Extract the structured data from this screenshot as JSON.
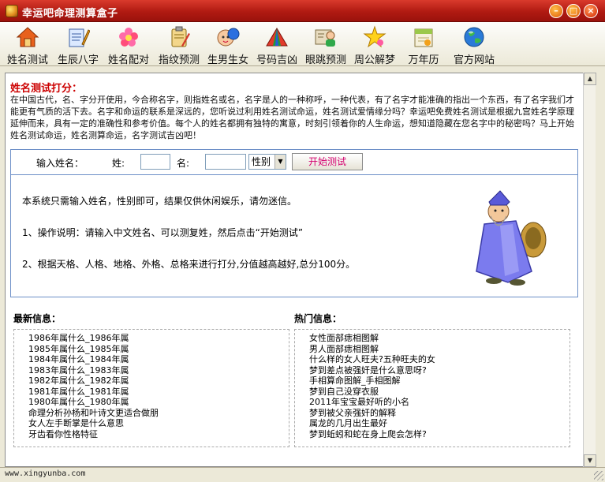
{
  "window": {
    "title": "幸运吧命理测算盒子"
  },
  "toolbar": [
    {
      "label": "姓名测试",
      "icon": "house-icon"
    },
    {
      "label": "生辰八字",
      "icon": "notepad-pen-icon"
    },
    {
      "label": "姓名配对",
      "icon": "flower-icon"
    },
    {
      "label": "指纹预测",
      "icon": "clipboard-icon"
    },
    {
      "label": "生男生女",
      "icon": "baby-icon"
    },
    {
      "label": "号码吉凶",
      "icon": "tent-icon"
    },
    {
      "label": "眼跳预测",
      "icon": "person-card-icon"
    },
    {
      "label": "周公解梦",
      "icon": "star-wand-icon"
    },
    {
      "label": "万年历",
      "icon": "calendar-icon"
    },
    {
      "label": "官方网站",
      "icon": "globe-icon"
    }
  ],
  "main": {
    "section_title": "姓名测试打分：",
    "intro": "在中国古代，名、字分开使用，今合称名字，则指姓名或名，名字是人的一种称呼，一种代表，有了名字才能准确的指出一个东西，有了名字我们才能更有气质的活下去。名字和命运的联系是深远的，您听说过利用姓名测试命运，姓名测试爱情缘分吗？幸运吧免费姓名测试是根据九宫姓名学原理延伸而来，具有一定的准确性和参考价值。每个人的姓名都拥有独特的寓意，时刻引领着你的人生命运，想知道隐藏在您名字中的秘密吗？马上开始姓名测试命运，姓名测算命运，名字测试吉凶吧！",
    "form": {
      "input_name_label": "输入姓名：",
      "surname_label": "姓:",
      "given_label": "名:",
      "surname_value": "",
      "given_value": "",
      "gender_selected": "性别",
      "start_button": "开始测试"
    },
    "notes": [
      "本系统只需输入姓名，性别即可，结果仅供休闲娱乐，请勿迷信。",
      "1、操作说明：请输入中文姓名、可以测复姓，然后点击“开始测试”",
      "2、根据天格、人格、地格、外格、总格来进行打分,分值越高越好,总分100分。"
    ],
    "latest_title": "最新信息：",
    "latest": [
      "1986年属什么_1986年属",
      "1985年属什么_1985年属",
      "1984年属什么_1984年属",
      "1983年属什么_1983年属",
      "1982年属什么_1982年属",
      "1981年属什么_1981年属",
      "1980年属什么_1980年属",
      "命理分析孙杨和叶诗文更适合做朋",
      "女人左手断掌是什么意思",
      "牙齿看你性格特征"
    ],
    "hot_title": "热门信息：",
    "hot": [
      "女性面部痣相图解",
      "男人面部痣相图解",
      "什么样的女人旺夫?五种旺夫的女",
      "梦到差点被强奸是什么意思呀?",
      "手相算命图解_手相图解",
      "梦到自己没穿衣服",
      "2011年宝宝最好听的小名",
      "梦到被父亲强奸的解释",
      "属龙的几月出生最好",
      "梦到蚯蚓和蛇在身上爬会怎样?"
    ]
  },
  "status": {
    "url": "www.xingyunba.com"
  }
}
